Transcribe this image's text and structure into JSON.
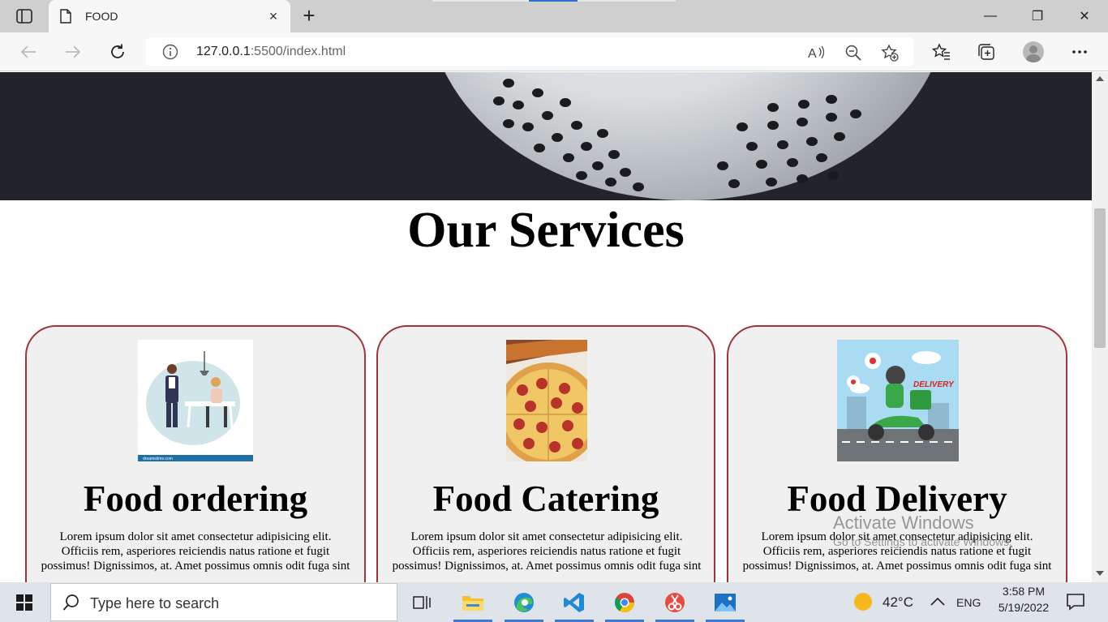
{
  "browser": {
    "tab_title": "FOOD",
    "tab_close": "×",
    "new_tab": "+",
    "url_host": "127.0.0.1",
    "url_rest": ":5500/index.html",
    "window_controls": {
      "minimize": "—",
      "restore": "❐",
      "close": "✕"
    }
  },
  "page": {
    "section_title": "Our Services",
    "cards": [
      {
        "title": "Food ordering",
        "text": "Lorem ipsum dolor sit amet consectetur adipisicing elit. Officiis rem, asperiores reiciendis natus ratione et fugit possimus! Dignissimos, at. Amet possimus omnis odit fuga sint"
      },
      {
        "title": "Food Catering",
        "text": "Lorem ipsum dolor sit amet consectetur adipisicing elit. Officiis rem, asperiores reiciendis natus ratione et fugit possimus! Dignissimos, at. Amet possimus omnis odit fuga sint"
      },
      {
        "title": "Food Delivery",
        "text": "Lorem ipsum dolor sit amet consectetur adipisicing elit. Officiis rem, asperiores reiciendis natus ratione et fugit possimus! Dignissimos, at. Amet possimus omnis odit fuga sint"
      }
    ],
    "delivery_image_label": "DELIVERY",
    "image_credit": "dreamstime.com"
  },
  "watermark": {
    "line1": "Activate Windows",
    "line2": "Go to Settings to activate Windows."
  },
  "taskbar": {
    "search_placeholder": "Type here to search",
    "weather": "42°C",
    "language": "ENG",
    "time": "3:58 PM",
    "date": "5/19/2022"
  },
  "colors": {
    "card_border": "#a3333a",
    "card_bg": "#f1f0f0",
    "hero_bg": "#23242a",
    "taskbar_bg": "#dfe3ea",
    "accent": "#3d7bd1"
  }
}
